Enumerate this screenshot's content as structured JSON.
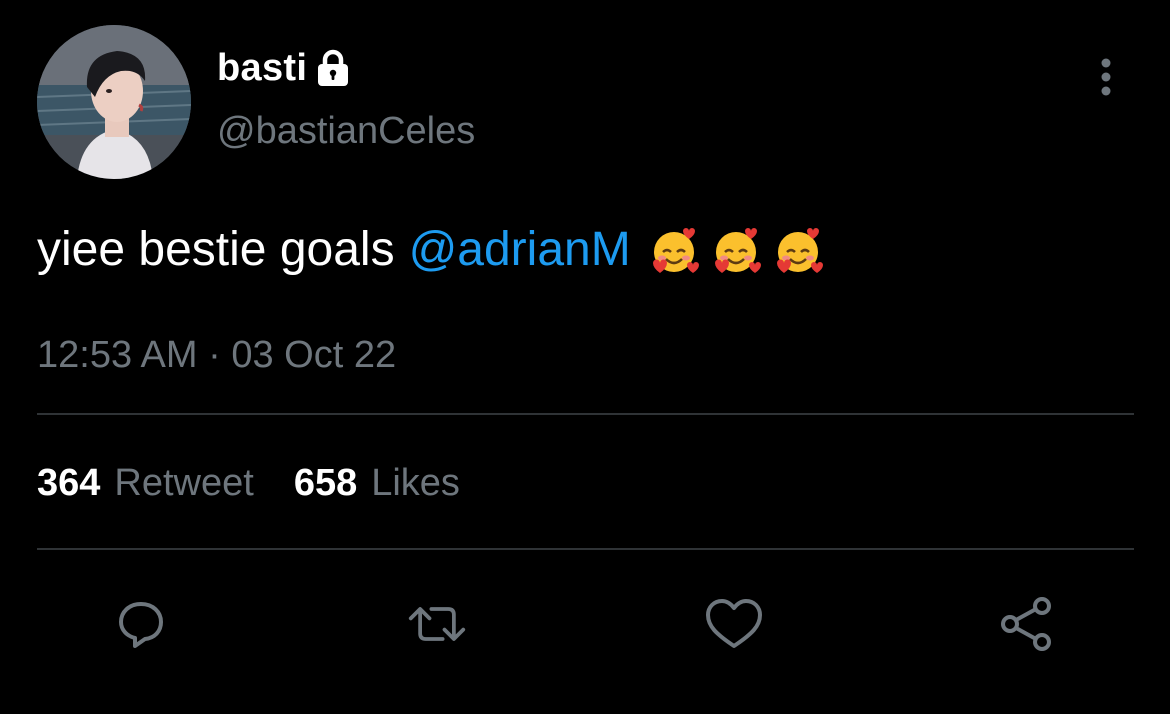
{
  "author": {
    "display_name": "basti",
    "handle": "@bastianCeles",
    "protected_icon": "lock-icon"
  },
  "tweet": {
    "text": "yiee bestie goals",
    "mention": "@adrianM",
    "emojis": [
      "smiling-face-with-hearts",
      "smiling-face-with-hearts",
      "smiling-face-with-hearts"
    ],
    "timestamp": "12:53 AM · 03 Oct 22"
  },
  "stats": {
    "retweets_count": "364",
    "retweets_label": "Retweet",
    "likes_count": "658",
    "likes_label": "Likes"
  },
  "actions": [
    "reply-icon",
    "retweet-icon",
    "like-icon",
    "share-icon"
  ],
  "colors": {
    "background": "#000000",
    "primary_text": "#ffffff",
    "secondary_text": "#6e767d",
    "accent": "#1d9bf0",
    "divider": "#2f3336"
  }
}
